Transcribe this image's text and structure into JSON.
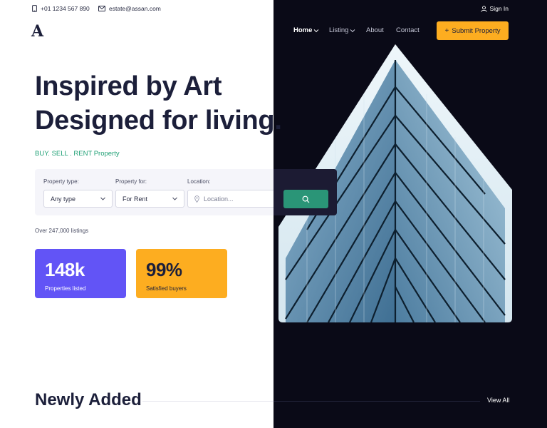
{
  "topbar": {
    "phone": "+01 1234 567 890",
    "email": "estate@assan.com",
    "sign_in": "Sign In"
  },
  "brand": {
    "logo": "A"
  },
  "nav": {
    "items": [
      {
        "label": "Home",
        "has_dropdown": true,
        "active": true
      },
      {
        "label": "Listing",
        "has_dropdown": true,
        "active": false
      },
      {
        "label": "About",
        "has_dropdown": false,
        "active": false
      },
      {
        "label": "Contact",
        "has_dropdown": false,
        "active": false
      }
    ],
    "submit_label": "Submit Property"
  },
  "hero": {
    "line1": "Inspired by Art",
    "line2": "Designed for living.",
    "tagline": "BUY. SELL . RENT Property"
  },
  "search": {
    "type_label": "Property type:",
    "type_value": "Any type",
    "for_label": "Property for:",
    "for_value": "For Rent",
    "location_label": "Location:",
    "location_placeholder": "Location..."
  },
  "listings_text": "Over 247,000 listings",
  "stats": [
    {
      "value": "148k",
      "label": "Properties listed",
      "color": "#6254f6"
    },
    {
      "value": "99%",
      "label": "Satisfied buyers",
      "color": "#fdad20"
    }
  ],
  "section": {
    "title": "Newly Added",
    "view_all": "View All"
  },
  "colors": {
    "dark_bg": "#0a0a17",
    "accent_yellow": "#fdad20",
    "accent_purple": "#6254f6",
    "accent_green": "#2a9577",
    "text_dark": "#1c1f3a"
  },
  "icons": [
    "phone-icon",
    "mail-icon",
    "user-icon",
    "chevron-down-icon",
    "plus-icon",
    "map-pin-icon",
    "search-icon"
  ]
}
